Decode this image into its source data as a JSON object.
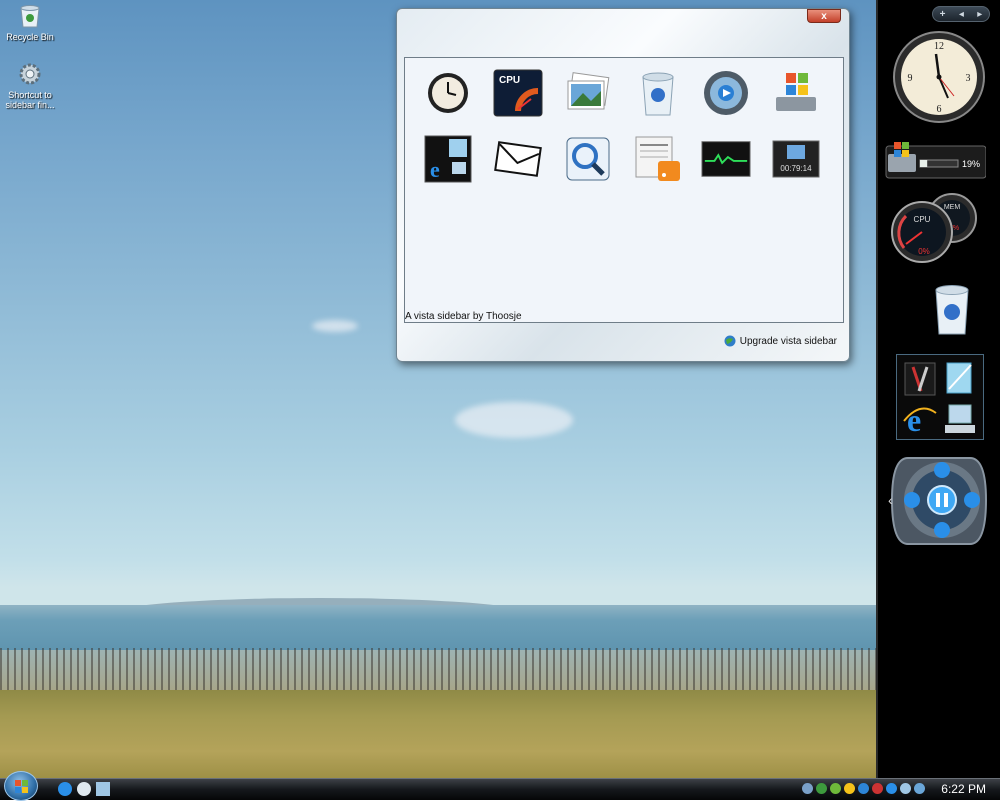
{
  "desktop": {
    "icons": [
      {
        "label": "Recycle Bin",
        "icon": "recycle-bin-icon"
      },
      {
        "label": "Shortcut to sidebar fin...",
        "icon": "gear-icon"
      }
    ]
  },
  "window": {
    "close_label": "x",
    "gallery_icons": [
      "clock-icon",
      "cpu-meter-icon",
      "slideshow-icon",
      "recycle-bin-icon",
      "media-player-icon",
      "windows-drive-icon",
      "app-launcher-icon",
      "mail-icon",
      "search-icon",
      "news-feed-icon",
      "network-monitor-icon",
      "computer-uptime-icon"
    ],
    "uptime_text": "00:79:14",
    "credit": "A vista sidebar by Thoosje",
    "upgrade_label": "Upgrade vista sidebar"
  },
  "sidebar": {
    "nav": {
      "add": "+",
      "prev": "◂",
      "next": "▸"
    },
    "drive_percent_text": "19%",
    "drive_percent": 19,
    "cpu_label": "CPU",
    "cpu_value": "0%",
    "mem_label": "MEM",
    "mem_value": "7%",
    "media_collapse": "‹"
  },
  "taskbar": {
    "time": "6:22 PM"
  },
  "colors": {
    "sidebar_bg": "#000000",
    "taskbar_bg": "#15181c",
    "close_red": "#c3402a"
  }
}
